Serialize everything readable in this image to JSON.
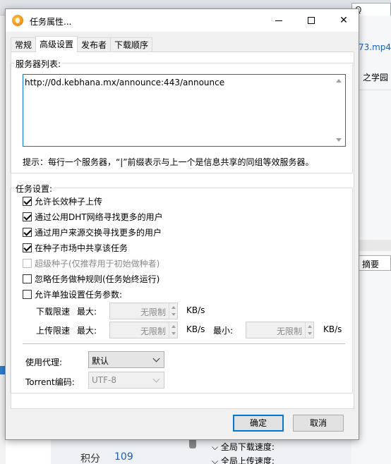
{
  "background": {
    "search_placeholder": "Q",
    "link_text": "73.mp4",
    "text2": "之学园",
    "tab_text": "摘要",
    "points_label": "积分",
    "points_value": "109",
    "stat_download": "全局下载速度:",
    "stat_upload": "全局上传速度:"
  },
  "dialog": {
    "title": "任务属性...",
    "tabs": [
      {
        "label": "常规"
      },
      {
        "label": "高级设置"
      },
      {
        "label": "发布者"
      },
      {
        "label": "下载顺序"
      }
    ],
    "server_group": {
      "title": "服务器列表:",
      "servers_text": "http://0d.kebhana.mx/announce:443/announce",
      "hint": "提示：每行一个服务器，“|”前缀表示与上一个是信息共享的同组等效服务器。"
    },
    "task_group": {
      "title": "任务设置:",
      "options": [
        {
          "label": "允许长效种子上传",
          "checked": true,
          "disabled": false
        },
        {
          "label": "通过公用DHT网络寻找更多的用户",
          "checked": true,
          "disabled": false
        },
        {
          "label": "通过用户来源交换寻找更多的用户",
          "checked": true,
          "disabled": false
        },
        {
          "label": "在种子市场中共享该任务",
          "checked": true,
          "disabled": false
        },
        {
          "label": "超级种子(仅推荐用于初始做种者)",
          "checked": false,
          "disabled": true
        },
        {
          "label": "忽略任务做种规则(任务始终运行)",
          "checked": false,
          "disabled": false
        },
        {
          "label": "允许单独设置任务参数:",
          "checked": false,
          "disabled": false
        }
      ],
      "download_limit_label": "下载限速",
      "upload_limit_label": "上传限速",
      "max_label": "最大:",
      "min_label": "最小:",
      "unlimited": "无限制",
      "unit": "KB/s"
    },
    "proxy_label": "使用代理:",
    "proxy_value": "默认",
    "encoding_label": "Torrent编码:",
    "encoding_value": "UTF-8",
    "ok_label": "确定",
    "cancel_label": "取消"
  }
}
